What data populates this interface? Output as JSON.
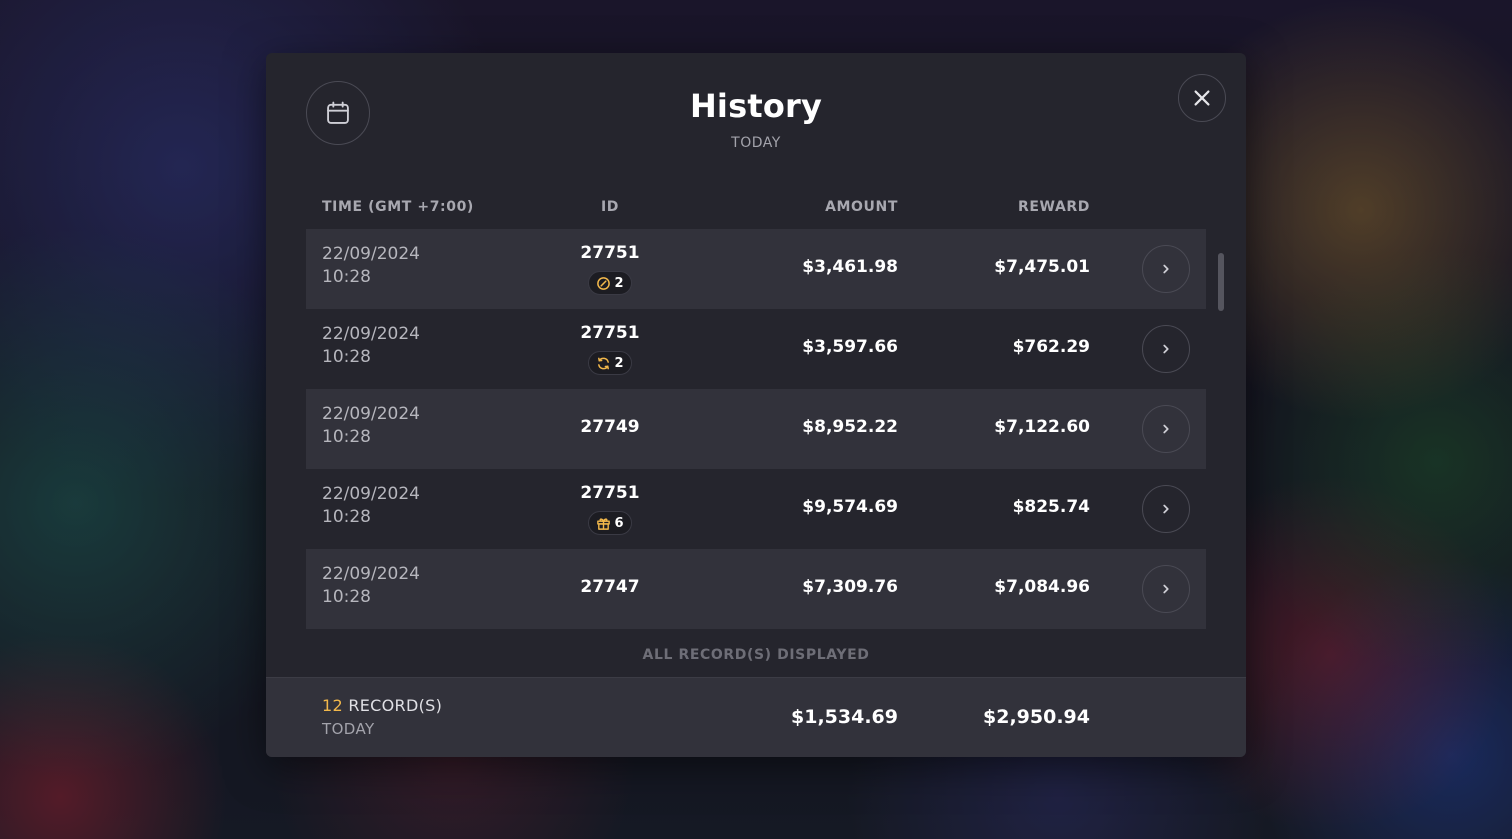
{
  "modal": {
    "title": "History",
    "subtitle": "TODAY"
  },
  "columns": {
    "time": "TIME (GMT +7:00)",
    "id": "ID",
    "amount": "AMOUNT",
    "reward": "REWARD"
  },
  "rows": [
    {
      "date": "22/09/2024",
      "time": "10:28",
      "id": "27751",
      "badge": {
        "icon": "coin-timer-icon",
        "count": "2"
      },
      "amount": "$3,461.98",
      "reward": "$7,475.01"
    },
    {
      "date": "22/09/2024",
      "time": "10:28",
      "id": "27751",
      "badge": {
        "icon": "refresh-icon",
        "count": "2"
      },
      "amount": "$3,597.66",
      "reward": "$762.29"
    },
    {
      "date": "22/09/2024",
      "time": "10:28",
      "id": "27749",
      "badge": null,
      "amount": "$8,952.22",
      "reward": "$7,122.60"
    },
    {
      "date": "22/09/2024",
      "time": "10:28",
      "id": "27751",
      "badge": {
        "icon": "gift-icon",
        "count": "6"
      },
      "amount": "$9,574.69",
      "reward": "$825.74"
    },
    {
      "date": "22/09/2024",
      "time": "10:28",
      "id": "27747",
      "badge": null,
      "amount": "$7,309.76",
      "reward": "$7,084.96"
    }
  ],
  "status": "ALL RECORD(S) DISPLAYED",
  "footer": {
    "count": "12",
    "records_label": "RECORD(S)",
    "period": "TODAY",
    "total_amount": "$1,534.69",
    "total_reward": "$2,950.94"
  },
  "colors": {
    "accent": "#f2b84b",
    "modal_bg": "#25252d",
    "row_alt_bg": "#32323b"
  }
}
